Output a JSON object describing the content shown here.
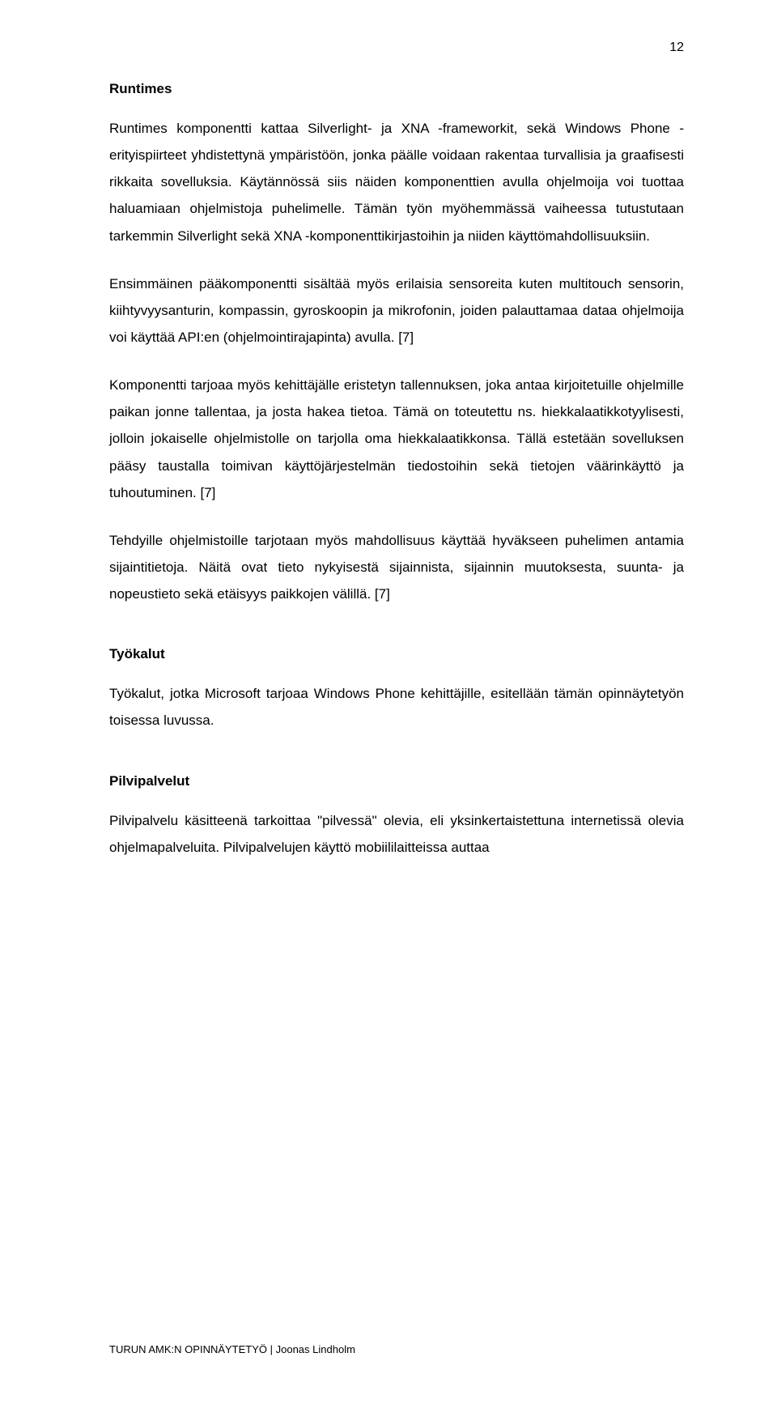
{
  "pageNumber": "12",
  "sections": {
    "runtimes": {
      "heading": "Runtimes",
      "p1": "Runtimes komponentti kattaa Silverlight- ja XNA -frameworkit, sekä Windows Phone -erityispiirteet yhdistettynä ympäristöön, jonka päälle voidaan rakentaa turvallisia ja graafisesti rikkaita sovelluksia. Käytännössä siis näiden komponenttien avulla ohjelmoija voi tuottaa haluamiaan ohjelmistoja puhelimelle. Tämän työn myöhemmässä vaiheessa tutustutaan tarkemmin Silverlight sekä XNA -komponenttikirjastoihin ja niiden käyttömahdollisuuksiin.",
      "p2": "Ensimmäinen pääkomponentti sisältää myös erilaisia sensoreita kuten multitouch sensorin, kiihtyvyysanturin, kompassin, gyroskoopin ja mikrofonin, joiden palauttamaa dataa ohjelmoija voi käyttää API:en (ohjelmointirajapinta) avulla. [7]",
      "p3": "Komponentti tarjoaa myös kehittäjälle eristetyn tallennuksen, joka antaa kirjoitetuille ohjelmille paikan jonne tallentaa, ja josta hakea tietoa. Tämä on toteutettu ns. hiekkalaatikkotyylisesti, jolloin jokaiselle ohjelmistolle on tarjolla oma hiekkalaatikkonsa. Tällä estetään sovelluksen pääsy taustalla toimivan käyttöjärjestelmän tiedostoihin sekä tietojen väärinkäyttö ja tuhoutuminen. [7]",
      "p4": "Tehdyille ohjelmistoille tarjotaan myös mahdollisuus käyttää hyväkseen puhelimen antamia sijaintitietoja. Näitä ovat tieto nykyisestä sijainnista, sijainnin muutoksesta, suunta- ja nopeustieto sekä etäisyys paikkojen välillä. [7]"
    },
    "tools": {
      "heading": "Työkalut",
      "p1": "Työkalut, jotka Microsoft tarjoaa Windows Phone kehittäjille, esitellään tämän opinnäytetyön toisessa luvussa."
    },
    "cloud": {
      "heading": "Pilvipalvelut",
      "p1": "Pilvipalvelu käsitteenä tarkoittaa \"pilvessä\" olevia, eli yksinkertaistettuna internetissä olevia ohjelmapalveluita. Pilvipalvelujen käyttö mobiililaitteissa auttaa"
    }
  },
  "footer": "TURUN AMK:N OPINNÄYTETYÖ | Joonas Lindholm"
}
